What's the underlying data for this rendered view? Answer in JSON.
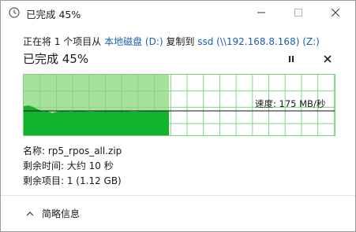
{
  "window": {
    "title": "已完成 45%"
  },
  "header": {
    "copy_prefix": "正在将 1 个项目从 ",
    "source": "本地磁盘 (D:)",
    "copy_middle": " 复制到 ",
    "destination": "ssd (\\\\192.168.8.168) (Z:)",
    "status": "已完成 45%"
  },
  "progress": {
    "fraction": 0.45
  },
  "graph": {
    "speed_label": "速度: 175 MB/秒"
  },
  "details": {
    "name_label": "名称: ",
    "name_value": "rp5_rpos_all.zip",
    "time_label": "剩余时间: ",
    "time_value": "大约 10 秒",
    "items_label": "剩余项目: ",
    "items_value": "1 (1.12 GB)"
  },
  "footer": {
    "less_details_label": "简略信息"
  },
  "icons": {
    "title": "copy-progress-icon",
    "minimize": "minimize-icon",
    "maximize": "maximize-icon",
    "close": "close-icon",
    "pause": "pause-icon",
    "stop": "stop-icon",
    "less": "chevron-up-icon"
  },
  "colors": {
    "graph_fill_light": "#a6e29c",
    "graph_fill_dark": "#12b12e",
    "graph_border": "#7fcf7f",
    "grid": "#7fd87f",
    "link": "#1a5fb4"
  }
}
